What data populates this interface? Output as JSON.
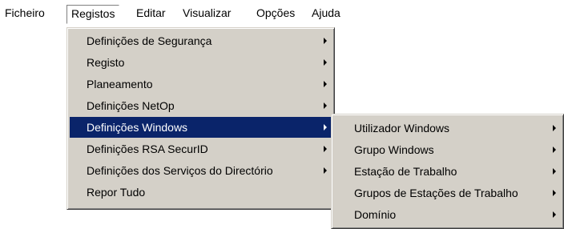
{
  "menubar": {
    "items": [
      "Ficheiro",
      "Registos",
      "Editar",
      "Visualizar",
      "Opções",
      "Ajuda"
    ]
  },
  "menu_registos": {
    "items": [
      "Definições de Segurança",
      "Registo",
      "Planeamento",
      "Definições NetOp",
      "Definições Windows",
      "Definições RSA SecurID",
      "Definições dos Serviços do Directório",
      "Repor Tudo"
    ]
  },
  "submenu_windows": {
    "items": [
      "Utilizador Windows",
      "Grupo Windows",
      "Estação de Trabalho",
      "Grupos de Estações de Trabalho",
      "Domínio"
    ]
  },
  "colors": {
    "highlight": "#0a246a",
    "menu_face": "#d4d0c8"
  }
}
